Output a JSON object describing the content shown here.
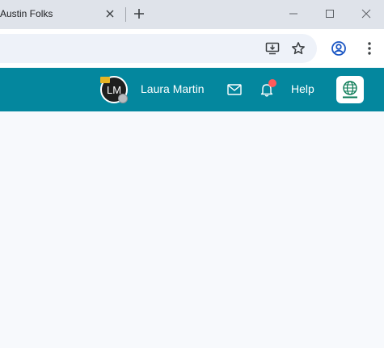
{
  "browser": {
    "tab_title": "Austin Folks",
    "close_tab_glyph": "×",
    "new_tab_glyph": "+",
    "icons": [
      "close-icon",
      "plus-icon",
      "minimize-icon",
      "maximize-icon",
      "close-window-icon",
      "install-app-icon",
      "star-icon",
      "profile-icon",
      "menu-icon"
    ]
  },
  "header": {
    "avatar_initials": "LM",
    "user_name": "Laura Martin",
    "help_label": "Help",
    "colors": {
      "header_bg": "#04879e",
      "notification_dot": "#ff5a5a",
      "avatar_flag": "#e8b524"
    },
    "icons": [
      "mail-icon",
      "bell-icon",
      "globe-logo-icon"
    ]
  }
}
